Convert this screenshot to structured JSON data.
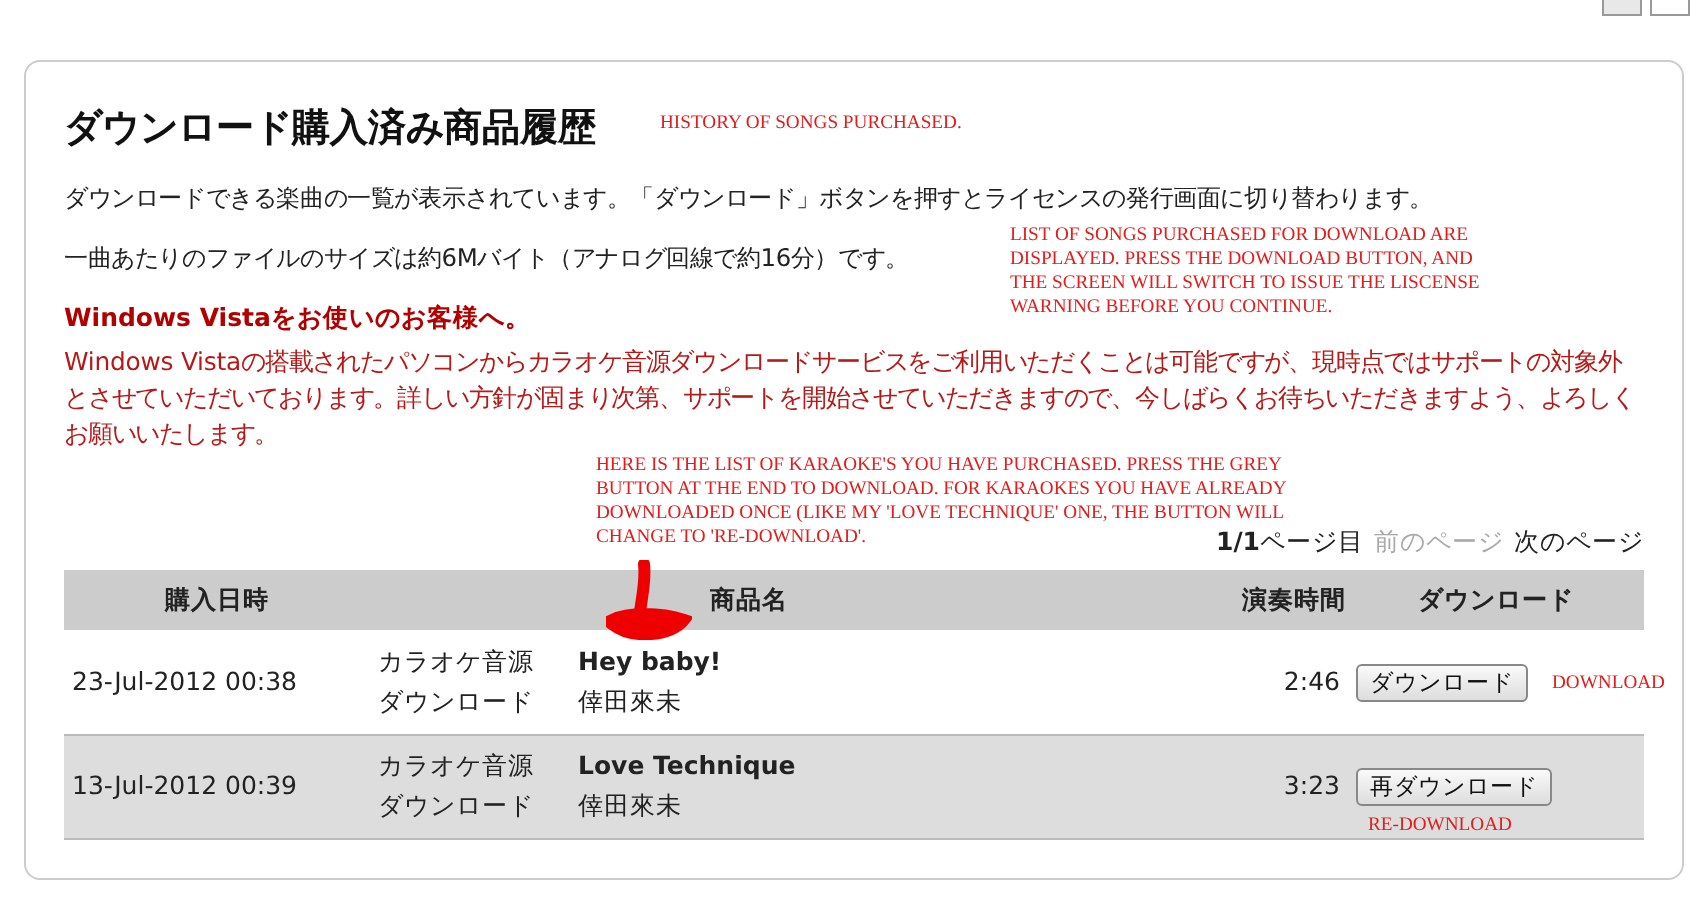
{
  "top_controls": [
    {
      "kind": "square"
    },
    {
      "kind": "square"
    }
  ],
  "title": "ダウンロード購入済み商品履歴",
  "intro": [
    "ダウンロードできる楽曲の一覧が表示されています。「ダウンロード」ボタンを押すとライセンスの発行画面に切り替わります。",
    "一曲あたりのファイルのサイズは約6Mバイト（アナログ回線で約16分）です。"
  ],
  "notice": {
    "title": "Windows Vistaをお使いのお客様へ。",
    "body": "Windows Vistaの搭載されたパソコンからカラオケ音源ダウンロードサービスをご利用いただくことは可能ですが、現時点ではサポートの対象外とさせていただいております。詳しい方針が固まり次第、サポートを開始させていただきますので、今しばらくお待ちいただきますよう、よろしくお願いいたします。"
  },
  "pager": {
    "status": "**1/1**ページ目",
    "links": [
      {
        "label": "前のページ",
        "disabled": true
      },
      {
        "label": "次のページ",
        "disabled": false
      }
    ]
  },
  "table": {
    "columns": [
      "購入日時",
      "商品名",
      "演奏時間",
      "ダウンロード"
    ],
    "rows": [
      {
        "date": "23-Jul-2012 00:38",
        "type": [
          "カラオケ音源",
          "ダウンロード"
        ],
        "song": "Hey baby!",
        "artist": "倖田來未",
        "duration": "2:46",
        "button": "ダウンロード"
      },
      {
        "date": "13-Jul-2012 00:39",
        "type": [
          "カラオケ音源",
          "ダウンロード"
        ],
        "song": "Love Technique",
        "artist": "倖田來未",
        "duration": "3:23",
        "button": "再ダウンロード"
      }
    ]
  },
  "annotations": [
    {
      "lines": [
        "HISTORY OF SONGS PURCHASED."
      ]
    },
    {
      "lines": [
        "LIST OF SONGS PURCHASED FOR DOWNLOAD ARE",
        "DISPLAYED. PRESS THE DOWNLOAD BUTTON, AND",
        "THE SCREEN WILL SWITCH TO ISSUE THE LISCENSE",
        "WARNING BEFORE YOU CONTINUE."
      ]
    },
    {
      "lines": [
        "HERE IS THE LIST OF KARAOKE'S YOU HAVE PURCHASED. PRESS THE GREY",
        "BUTTON AT THE END TO DOWNLOAD. FOR KARAOKES YOU HAVE ALREADY",
        "DOWNLOADED ONCE (LIKE MY 'LOVE TECHNIQUE' ONE, THE BUTTON WILL",
        "CHANGE TO 'RE-DOWNLOAD'."
      ]
    },
    {
      "lines": [
        "DOWNLOAD"
      ]
    },
    {
      "lines": [
        "RE-DOWNLOAD"
      ]
    }
  ]
}
